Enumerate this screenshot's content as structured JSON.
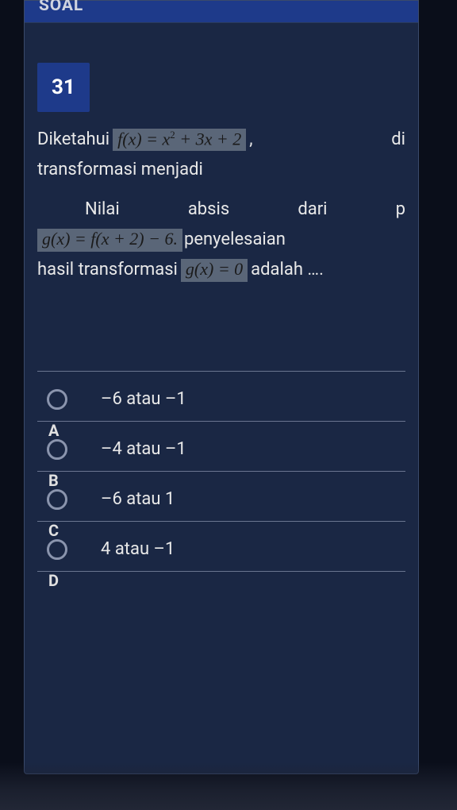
{
  "header": "SOAL",
  "question": {
    "number": "31",
    "text_pre_formula1": "Diketahui",
    "formula1": "f(x) = x² + 3x + 2",
    "text_post_formula1_a": ",",
    "text_post_formula1_b": "di",
    "line2": "transformasi menjadi",
    "line3_w1": "Nilai",
    "line3_w2": "absis",
    "line3_w3": "dari",
    "line3_w4": "p",
    "formula2": "g(x) = f(x + 2) − 6.",
    "text_post_formula2": "penyelesaian",
    "line5_pre": "hasil transformasi",
    "formula3": "g(x) = 0",
    "line5_post": "adalah …."
  },
  "options": [
    {
      "letter": "A",
      "text": "–6 atau –1"
    },
    {
      "letter": "B",
      "text": "–4 atau –1"
    },
    {
      "letter": "C",
      "text": "–6 atau 1"
    },
    {
      "letter": "D",
      "text": "4 atau –1"
    }
  ]
}
